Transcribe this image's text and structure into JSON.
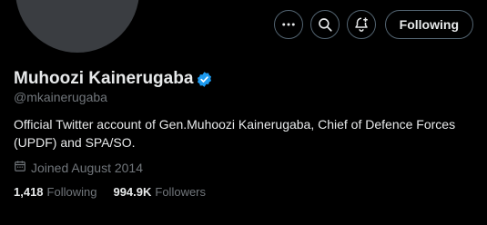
{
  "profile": {
    "name": "Muhoozi Kainerugaba",
    "handle": "@mkainerugaba",
    "bio": "Official Twitter account of Gen.Muhoozi Kainerugaba, Chief of Defence Forces (UPDF) and SPA/SO.",
    "joined": "Joined August 2014",
    "verified_badge_color": "#1d9bf0"
  },
  "actions": {
    "more_icon": "more-horizontal-icon",
    "search_icon": "search-icon",
    "notify_icon": "bell-plus-icon",
    "follow_label": "Following"
  },
  "stats": {
    "following_count": "1,418",
    "following_label": "Following",
    "followers_count": "994.9K",
    "followers_label": "Followers"
  },
  "colors": {
    "background": "#000000",
    "text_primary": "#e7e9ea",
    "text_secondary": "#71767b",
    "border": "#536471"
  }
}
